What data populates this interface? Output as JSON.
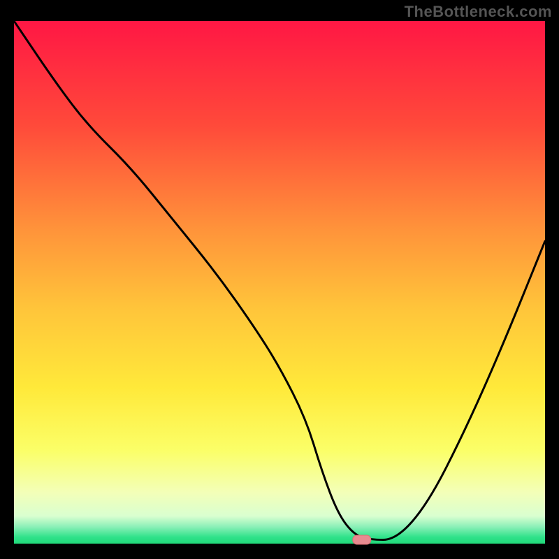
{
  "watermark": "TheBottleneck.com",
  "chart_data": {
    "type": "line",
    "title": "",
    "xlabel": "",
    "ylabel": "",
    "xlim": [
      0,
      100
    ],
    "ylim": [
      0,
      100
    ],
    "grid": false,
    "legend": null,
    "watermark_text": "TheBottleneck.com",
    "background_gradient_stops": [
      {
        "offset": 0.0,
        "color": "#ff1744"
      },
      {
        "offset": 0.2,
        "color": "#ff4a3a"
      },
      {
        "offset": 0.4,
        "color": "#ff943a"
      },
      {
        "offset": 0.55,
        "color": "#ffc53a"
      },
      {
        "offset": 0.7,
        "color": "#ffe93a"
      },
      {
        "offset": 0.82,
        "color": "#fbff68"
      },
      {
        "offset": 0.9,
        "color": "#f3ffb8"
      },
      {
        "offset": 0.945,
        "color": "#d9ffd0"
      },
      {
        "offset": 0.965,
        "color": "#8cf0b8"
      },
      {
        "offset": 0.985,
        "color": "#2fe28a"
      },
      {
        "offset": 1.0,
        "color": "#1fd676"
      }
    ],
    "series": [
      {
        "name": "bottleneck-curve",
        "x": [
          0,
          8,
          14,
          22,
          30,
          38,
          45,
          50,
          55,
          58,
          61,
          64,
          67,
          72,
          78,
          85,
          92,
          100
        ],
        "values": [
          100,
          88,
          80,
          72,
          62,
          52,
          42,
          34,
          24,
          14,
          6,
          2,
          1,
          1,
          8,
          22,
          38,
          58
        ]
      }
    ],
    "marker": {
      "x": 65.5,
      "y": 1,
      "color": "#e88a90"
    },
    "annotations": []
  }
}
